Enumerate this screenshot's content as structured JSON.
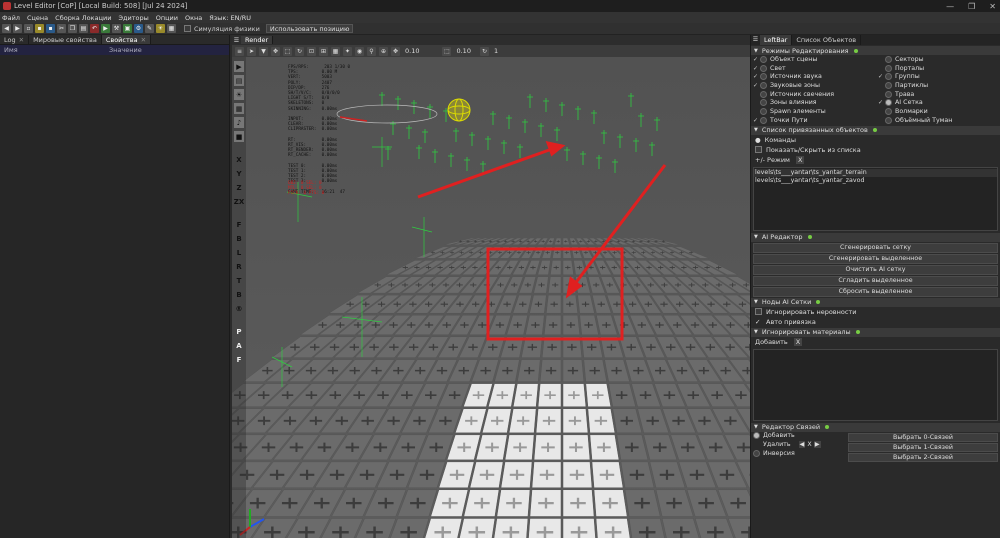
{
  "window": {
    "title": "Level Editor [CoP] [Local Build: 508] [Jul 24 2024]",
    "controls": [
      "—",
      "❐",
      "✕"
    ]
  },
  "menu": [
    "Файл",
    "Сцена",
    "Сборка Локации",
    "Эдиторы",
    "Опции",
    "Окна",
    "Язык: EN/RU"
  ],
  "toolbar": {
    "physics_label": "Симуляция физики",
    "use_position_label": "Использовать позицию"
  },
  "left_panel": {
    "tabs": [
      {
        "label": "Log",
        "closable": true
      },
      {
        "label": "Мировые свойства",
        "closable": false
      },
      {
        "label": "Свойства",
        "closable": true
      }
    ],
    "columns": [
      "Имя",
      "Значение"
    ]
  },
  "viewport": {
    "tab_label": "Render",
    "snap_values": [
      "0.10",
      "0.10",
      "1"
    ],
    "side_letters": [
      "X",
      "Y",
      "Z",
      "ZX",
      "F",
      "B",
      "L",
      "R",
      "T",
      "B",
      "P",
      "A",
      "F"
    ],
    "stats_text": "FPS/RPS:      203 1/30 0\nTPS:         0.00 M\nVERT:        5003\nPOLY:        2407\nDIP/DP:      276\nSH/T/V/C:    0/0/0/0\nLIGHT S/T:   0/0\nSKELETONS:   0\nSKINNING:    0.00ms\n\nINPUT:       0.00ms\nCLEAR:       0.00ms\nCLIPRASTER:  0.00ms\n\nRT:          0.00ms\nRT_VIS:      0.00ms\nRT_RENDER:   0.00ms\nRT_CACHE:    0.00ms\n\nTEST 0:      0.00ms\nTEST 1:      0.00ms\nTEST 2:      0.00ms\nTEST 3:      0.00ms\n\nGAME TIME:   16:21  47",
    "stats_red_text": "OBJ: 0 SEL: 0\nMTL: 0 SEL: 0\nPICK: 0 PTS: 0"
  },
  "right_panel": {
    "tabs": [
      {
        "label": "LeftBar",
        "closable": false
      },
      {
        "label": "Список Объектов",
        "closable": false
      }
    ],
    "edit_modes": {
      "title": "Режимы Редактирования",
      "left": [
        {
          "label": "Объект сцены",
          "checked": true,
          "radio": false
        },
        {
          "label": "Свет",
          "checked": true,
          "radio": false
        },
        {
          "label": "Источник звука",
          "checked": true,
          "radio": false
        },
        {
          "label": "Звуковые зоны",
          "checked": true,
          "radio": false
        },
        {
          "label": "Источник свечения",
          "checked": false,
          "radio": false
        },
        {
          "label": "Зоны влияния",
          "checked": false,
          "radio": false
        },
        {
          "label": "Spawn элементы",
          "checked": false,
          "radio": false
        },
        {
          "label": "Точки Пути",
          "checked": true,
          "radio": false
        }
      ],
      "right": [
        {
          "label": "Секторы",
          "checked": false,
          "radio": false
        },
        {
          "label": "Порталы",
          "checked": false,
          "radio": false
        },
        {
          "label": "Группы",
          "checked": true,
          "radio": false
        },
        {
          "label": "Партиклы",
          "checked": false,
          "radio": false
        },
        {
          "label": "Трава",
          "checked": false,
          "radio": false
        },
        {
          "label": "AI Сетка",
          "checked": true,
          "radio": true
        },
        {
          "label": "Волмарки",
          "checked": false,
          "radio": false
        },
        {
          "label": "Объёмный Туман",
          "checked": false,
          "radio": false
        }
      ]
    },
    "attached": {
      "title": "Список привязанных объектов",
      "commands_label": "Команды",
      "show_hide_label": "Показать/Скрыть из списка",
      "mode_label": "+/- Режим",
      "x_label": "X",
      "items": [
        "levels\\ts___yantar\\ts_yantar_terrain",
        "levels\\ts___yantar\\ts_yantar_zavod"
      ]
    },
    "ai_editor": {
      "title": "AI Редактор",
      "buttons": [
        "Сгенерировать сетку",
        "Сгенерировать выделенное",
        "Очистить AI сетку",
        "Сгладить выделенное",
        "Сбросить выделенное"
      ]
    },
    "ai_nodes": {
      "title": "Ноды AI Сетки",
      "options": [
        {
          "label": "Игнорировать неровности",
          "checked": false
        },
        {
          "label": "Авто привязка",
          "checked": true
        }
      ]
    },
    "ignore_materials": {
      "title": "Игнорировать материалы",
      "add_label": "Добавить",
      "x_label": "X"
    },
    "link_editor": {
      "title": "Редактор Связей",
      "add_label": "Добавить",
      "remove_label": "Удалить",
      "invert_label": "Инверсия",
      "select_buttons": [
        "Выбрать 0-Связей",
        "Выбрать 1-Связей",
        "Выбрать 2-Связей"
      ]
    }
  }
}
